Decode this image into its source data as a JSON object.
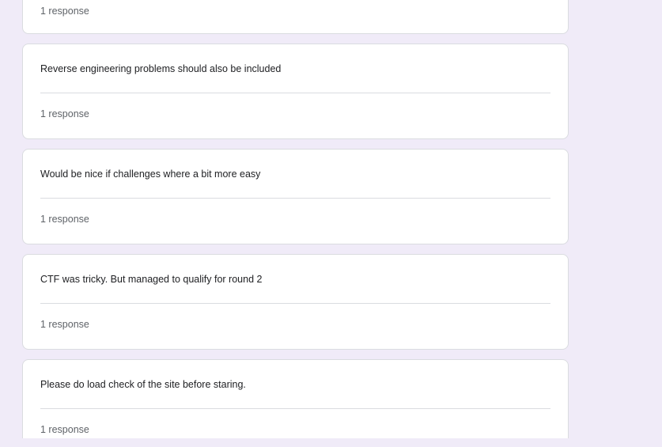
{
  "responses": [
    {
      "answer": "",
      "count_label": "1 response"
    },
    {
      "answer": "Reverse engineering problems should also be included",
      "count_label": "1 response"
    },
    {
      "answer": "Would be nice if challenges where a bit more easy",
      "count_label": "1 response"
    },
    {
      "answer": "CTF was tricky. But managed to qualify for round 2",
      "count_label": "1 response"
    },
    {
      "answer": "Please do load check of the site before staring.",
      "count_label": "1 response"
    }
  ],
  "colors": {
    "page_background": "#f0ebf8",
    "card_background": "#ffffff",
    "card_border": "#dadce0",
    "answer_text": "#202124",
    "count_text": "#5f6368"
  }
}
